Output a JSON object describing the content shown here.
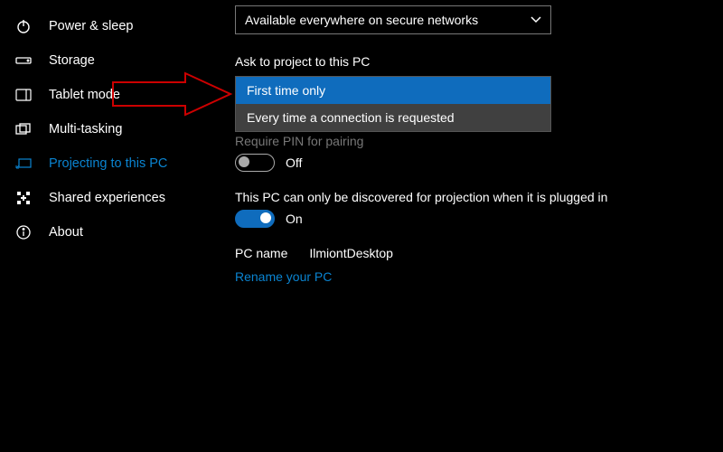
{
  "sidebar": {
    "items": [
      {
        "label": "Power & sleep"
      },
      {
        "label": "Storage"
      },
      {
        "label": "Tablet mode"
      },
      {
        "label": "Multi-tasking"
      },
      {
        "label": "Projecting to this PC"
      },
      {
        "label": "Shared experiences"
      },
      {
        "label": "About"
      }
    ]
  },
  "main": {
    "availability_dropdown": {
      "value": "Available everywhere on secure networks"
    },
    "ask_label": "Ask to project to this PC",
    "ask_options": [
      "First time only",
      "Every time a connection is requested"
    ],
    "require_pin_label": "Require PIN for pairing",
    "require_pin_toggle": "Off",
    "discover_label": "This PC can only be discovered for projection when it is plugged in",
    "discover_toggle": "On",
    "pc_name_label": "PC name",
    "pc_name_value": "IlmiontDesktop",
    "rename_link": "Rename your PC"
  }
}
